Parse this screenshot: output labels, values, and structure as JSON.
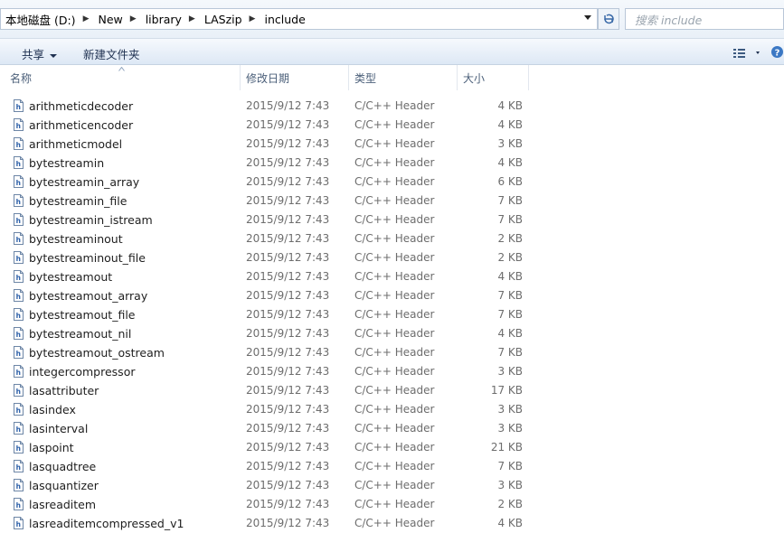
{
  "breadcrumb": [
    "本地磁盘 (D:)",
    "New",
    "library",
    "LASzip",
    "include"
  ],
  "search": {
    "placeholder": "搜索 include"
  },
  "toolbar": {
    "share_label": "共享",
    "new_folder_label": "新建文件夹"
  },
  "columns": {
    "name": "名称",
    "modified": "修改日期",
    "type": "类型",
    "size": "大小"
  },
  "files": [
    {
      "name": "arithmeticdecoder",
      "modified": "2015/9/12 7:43",
      "type": "C/C++ Header",
      "size": "4 KB"
    },
    {
      "name": "arithmeticencoder",
      "modified": "2015/9/12 7:43",
      "type": "C/C++ Header",
      "size": "4 KB"
    },
    {
      "name": "arithmeticmodel",
      "modified": "2015/9/12 7:43",
      "type": "C/C++ Header",
      "size": "3 KB"
    },
    {
      "name": "bytestreamin",
      "modified": "2015/9/12 7:43",
      "type": "C/C++ Header",
      "size": "4 KB"
    },
    {
      "name": "bytestreamin_array",
      "modified": "2015/9/12 7:43",
      "type": "C/C++ Header",
      "size": "6 KB"
    },
    {
      "name": "bytestreamin_file",
      "modified": "2015/9/12 7:43",
      "type": "C/C++ Header",
      "size": "7 KB"
    },
    {
      "name": "bytestreamin_istream",
      "modified": "2015/9/12 7:43",
      "type": "C/C++ Header",
      "size": "7 KB"
    },
    {
      "name": "bytestreaminout",
      "modified": "2015/9/12 7:43",
      "type": "C/C++ Header",
      "size": "2 KB"
    },
    {
      "name": "bytestreaminout_file",
      "modified": "2015/9/12 7:43",
      "type": "C/C++ Header",
      "size": "2 KB"
    },
    {
      "name": "bytestreamout",
      "modified": "2015/9/12 7:43",
      "type": "C/C++ Header",
      "size": "4 KB"
    },
    {
      "name": "bytestreamout_array",
      "modified": "2015/9/12 7:43",
      "type": "C/C++ Header",
      "size": "7 KB"
    },
    {
      "name": "bytestreamout_file",
      "modified": "2015/9/12 7:43",
      "type": "C/C++ Header",
      "size": "7 KB"
    },
    {
      "name": "bytestreamout_nil",
      "modified": "2015/9/12 7:43",
      "type": "C/C++ Header",
      "size": "4 KB"
    },
    {
      "name": "bytestreamout_ostream",
      "modified": "2015/9/12 7:43",
      "type": "C/C++ Header",
      "size": "7 KB"
    },
    {
      "name": "integercompressor",
      "modified": "2015/9/12 7:43",
      "type": "C/C++ Header",
      "size": "3 KB"
    },
    {
      "name": "lasattributer",
      "modified": "2015/9/12 7:43",
      "type": "C/C++ Header",
      "size": "17 KB"
    },
    {
      "name": "lasindex",
      "modified": "2015/9/12 7:43",
      "type": "C/C++ Header",
      "size": "3 KB"
    },
    {
      "name": "lasinterval",
      "modified": "2015/9/12 7:43",
      "type": "C/C++ Header",
      "size": "3 KB"
    },
    {
      "name": "laspoint",
      "modified": "2015/9/12 7:43",
      "type": "C/C++ Header",
      "size": "21 KB"
    },
    {
      "name": "lasquadtree",
      "modified": "2015/9/12 7:43",
      "type": "C/C++ Header",
      "size": "7 KB"
    },
    {
      "name": "lasquantizer",
      "modified": "2015/9/12 7:43",
      "type": "C/C++ Header",
      "size": "3 KB"
    },
    {
      "name": "lasreaditem",
      "modified": "2015/9/12 7:43",
      "type": "C/C++ Header",
      "size": "2 KB"
    },
    {
      "name": "lasreaditemcompressed_v1",
      "modified": "2015/9/12 7:43",
      "type": "C/C++ Header",
      "size": "4 KB"
    }
  ]
}
